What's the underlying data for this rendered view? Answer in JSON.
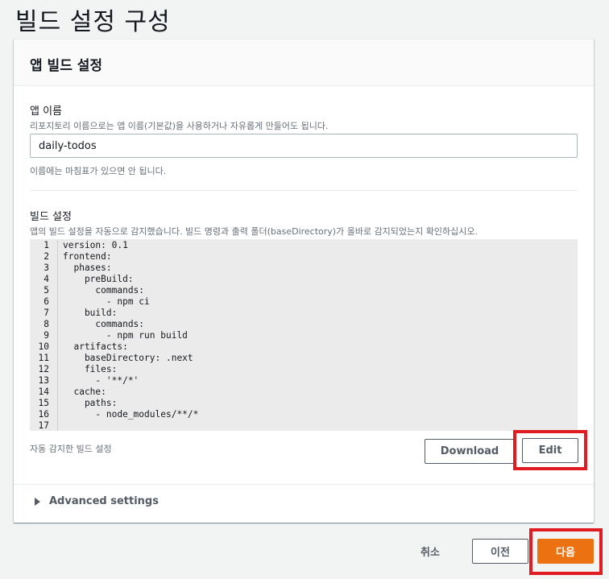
{
  "page": {
    "title": "빌드 설정 구성"
  },
  "panel": {
    "title": "앱 빌드 설정",
    "app_name": {
      "label": "앱 이름",
      "description": "리포지토리 이름으로는 앱 이름(기본값)을 사용하거나 자유롭게 만들어도 됩니다.",
      "value": "daily-todos",
      "constraint": "이름에는 마침표가 있으면 안 됩니다."
    },
    "build_settings": {
      "label": "빌드 설정",
      "description": "앱의 빌드 설정을 자동으로 감지했습니다. 빌드 명령과 출력 폴더(baseDirectory)가 올바로 감지되었는지 확인하십시오.",
      "code_lines": [
        "version: 0.1",
        "frontend:",
        "  phases:",
        "    preBuild:",
        "      commands:",
        "        - npm ci",
        "    build:",
        "      commands:",
        "        - npm run build",
        "  artifacts:",
        "    baseDirectory: .next",
        "    files:",
        "      - '**/*'",
        "  cache:",
        "    paths:",
        "      - node_modules/**/*",
        ""
      ],
      "caption": "자동 감지한 빌드 설정",
      "download_label": "Download",
      "edit_label": "Edit"
    },
    "advanced_label": "Advanced settings"
  },
  "footer": {
    "cancel_label": "취소",
    "previous_label": "이전",
    "next_label": "다음"
  },
  "colors": {
    "primary": "#ec7211",
    "highlight": "#e11b22"
  }
}
